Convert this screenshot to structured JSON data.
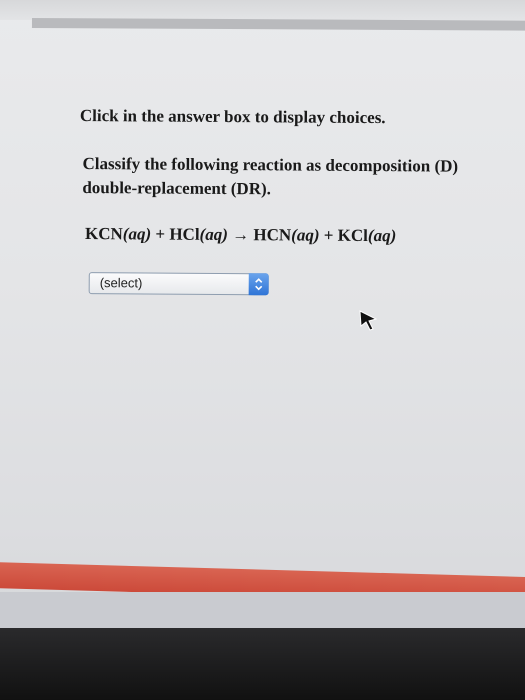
{
  "instruction": "Click in the answer box to display choices.",
  "question": {
    "line1": "Classify the following reaction as decomposition (D)",
    "line2": "double-replacement (DR)."
  },
  "equation": {
    "r1": "KCN",
    "r1_state": "(aq)",
    "plus1": " + ",
    "r2": "HCl",
    "r2_state": "(aq)",
    "arrow": " → ",
    "p1": "HCN",
    "p1_state": "(aq)",
    "plus2": " + ",
    "p2": "KCl",
    "p2_state": "(aq)"
  },
  "answer_select": {
    "selected": "(select)"
  },
  "colors": {
    "select_accent": "#3a7fe0",
    "banner_red": "#d4533f"
  },
  "icons": {
    "select_arrow": "up-down-chevron-icon",
    "cursor": "mouse-pointer-icon"
  }
}
